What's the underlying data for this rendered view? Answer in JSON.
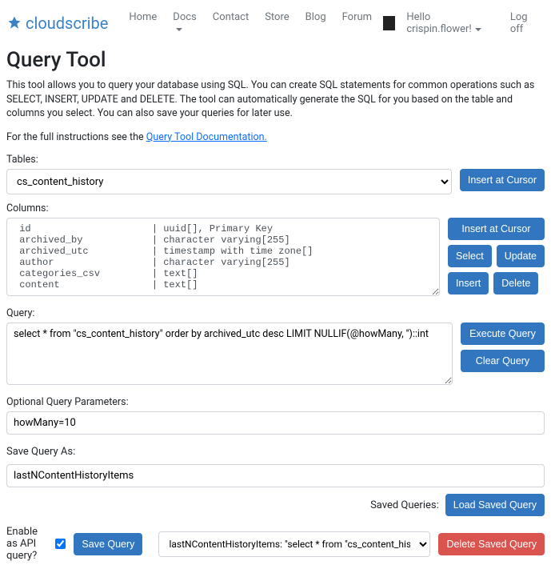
{
  "brand": "cloudscribe",
  "nav": {
    "home": "Home",
    "docs": "Docs",
    "contact": "Contact",
    "store": "Store",
    "blog": "Blog",
    "forum": "Forum",
    "greeting": "Hello crispin.flower!",
    "logoff": "Log off"
  },
  "page": {
    "title": "Query Tool",
    "desc1": "This tool allows you to query your database using SQL. You can create SQL statements for common operations such as SELECT, INSERT, UPDATE and DELETE. The tool can automatically generate the SQL for you based on the table and columns you select. You can also save your queries for later use.",
    "desc2_pre": "For the full instructions see the ",
    "desc2_link": "Query Tool Documentation.",
    "tables_label": "Tables:",
    "columns_label": "Columns:",
    "query_label": "Query:",
    "params_label": "Optional Query Parameters:",
    "save_as_label": "Save Query As:",
    "api_label": "Enable as API query?",
    "saved_label": "Saved Queries:"
  },
  "tables": {
    "selected": "cs_content_history"
  },
  "columns_text": " id                     | uuid[], Primary Key\n archived_by            | character varying[255]\n archived_utc           | timestamp with time zone[]\n author                 | character varying[255]\n categories_csv         | text[]\n content                | text[]",
  "query_text": "select * from \"cs_content_history\" order by archived_utc desc LIMIT NULLIF(@howMany, '')::int",
  "params_text": "howMany=10",
  "save_as_value": "lastNContentHistoryItems",
  "saved_selected": "lastNContentHistoryItems:  \"select * from \"cs_content_history\" orde...\"  (API ✅)",
  "buttons": {
    "insert_cursor": "Insert at Cursor",
    "select": "Select",
    "update": "Update",
    "insert": "Insert",
    "delete": "Delete",
    "execute": "Execute Query",
    "clear": "Clear Query",
    "save": "Save Query",
    "load_saved": "Load Saved Query",
    "delete_saved": "Delete Saved Query"
  }
}
